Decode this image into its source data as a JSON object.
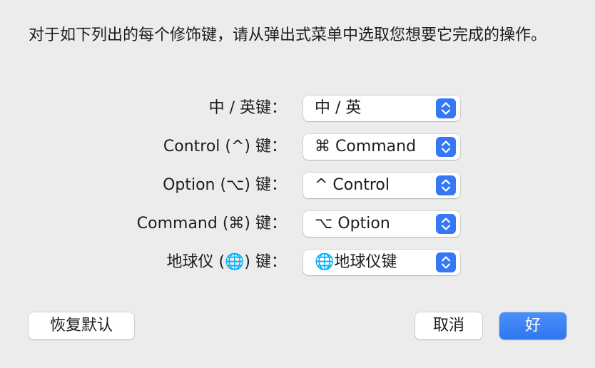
{
  "dialog": {
    "instructions": "对于如下列出的每个修饰键，请从弹出式菜单中选取您想要它完成的操作。"
  },
  "rows": [
    {
      "label": "中 / 英键：",
      "value": "中 / 英",
      "icon": "chevron-up-down-icon"
    },
    {
      "label": "Control (^) 键：",
      "value": "⌘ Command",
      "icon": "chevron-up-down-icon"
    },
    {
      "label": "Option (⌥) 键：",
      "value": "^ Control",
      "icon": "chevron-up-down-icon"
    },
    {
      "label": "Command (⌘) 键：",
      "value": "⌥ Option",
      "icon": "chevron-up-down-icon"
    },
    {
      "label": "地球仪 (🌐) 键：",
      "value": "🌐地球仪键",
      "icon": "chevron-up-down-icon"
    }
  ],
  "buttons": {
    "restore_defaults": "恢复默认",
    "cancel": "取消",
    "ok": "好"
  },
  "colors": {
    "accent": "#3478f6",
    "background": "#ececec"
  }
}
